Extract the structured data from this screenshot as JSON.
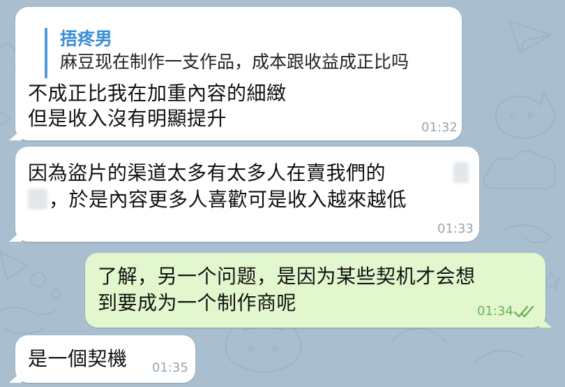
{
  "messages": [
    {
      "reply_name": "捂疼男",
      "reply_text": "麻豆现在制作一支作品，成本跟收益成正比吗",
      "line1": "不成正比我在加重內容的細緻",
      "line2": "但是收入沒有明顯提升",
      "time": "01:32"
    },
    {
      "line1": "因為盜片的渠道太多有太多人在賣我們的",
      "line2": "，於是內容更多人喜歡可是收入越來越低",
      "time": "01:33"
    },
    {
      "line1": "了解，另一个问题，是因为某些契机才会想",
      "line2": "到要成为一个制作商呢",
      "time": "01:34"
    },
    {
      "line1": "是一個契機",
      "time": "01:35"
    }
  ],
  "colors": {
    "background": "#a9bfd0",
    "incoming": "#ffffff",
    "outgoing": "#e2f7cd",
    "reply_accent": "#4f9bdc",
    "read_check": "#6db35a"
  },
  "icons": {
    "read_status": "double-check-icon"
  }
}
